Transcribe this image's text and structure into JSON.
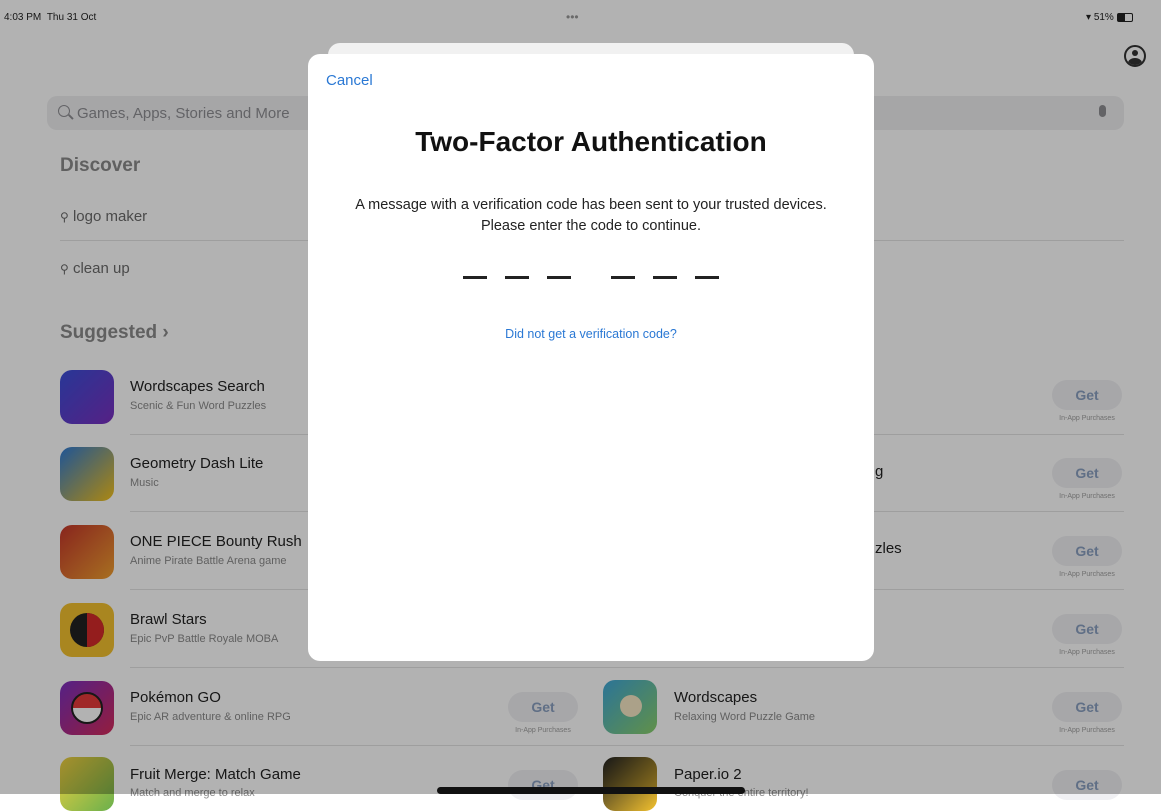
{
  "status_bar": {
    "time": "4:03 PM",
    "date": "Thu 31 Oct",
    "dots": "•••",
    "battery": "51%"
  },
  "search": {
    "placeholder": "Games, Apps, Stories and More"
  },
  "discover": {
    "title": "Discover",
    "items": [
      "logo maker",
      "clean up"
    ]
  },
  "suggested": {
    "title": "Suggested",
    "chevron": "›"
  },
  "apps_left": [
    {
      "name": "Wordscapes Search",
      "subtitle": "Scenic & Fun Word Puzzles"
    },
    {
      "name": "Geometry Dash Lite",
      "subtitle": "Music"
    },
    {
      "name": "ONE PIECE Bounty Rush",
      "subtitle": "Anime Pirate Battle Arena game"
    },
    {
      "name": "Brawl Stars",
      "subtitle": "Epic PvP Battle Royale MOBA"
    },
    {
      "name": "Pokémon GO",
      "subtitle": "Epic AR adventure & online RPG"
    },
    {
      "name": "Fruit Merge: Match Game",
      "subtitle": "Match and merge to relax"
    }
  ],
  "apps_right": [
    {
      "name": "Wordscapes",
      "subtitle": "Relaxing Word Puzzle Game"
    },
    {
      "name": "Paper.io 2",
      "subtitle": "Conquer the entire territory!"
    }
  ],
  "right_fragments": [
    "g",
    "zles"
  ],
  "get_label": "Get",
  "iap_label": "In-App Purchases",
  "modal": {
    "cancel": "Cancel",
    "title": "Two-Factor Authentication",
    "message": "A message with a verification code has been sent to your trusted devices. Please enter the code to continue.",
    "resend": "Did not get a verification code?",
    "code_slots": 6
  },
  "colors": {
    "link": "#2a78d4",
    "dim_overlay": "rgba(0,0,0,0.30)"
  }
}
